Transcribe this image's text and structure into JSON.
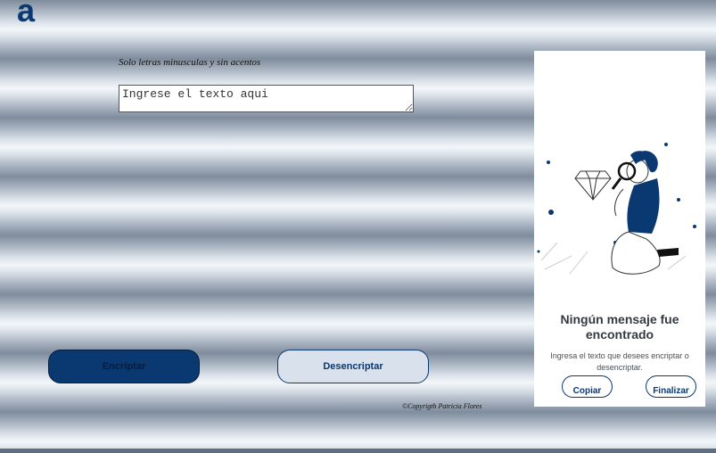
{
  "header": {
    "logo_text": "a"
  },
  "form": {
    "hint": "Solo letras minusculas y sin acentos",
    "input_placeholder": "Ingrese el texto aqui",
    "input_value": ""
  },
  "actions": {
    "encrypt_label": "Encriptar",
    "decrypt_label": "Desencriptar"
  },
  "footer": {
    "copyright": "©Copyrigth Patricia Flores"
  },
  "output_panel": {
    "title": "Ningún mensaje fue encontrado",
    "description": "Ingresa el texto que desees encriptar o desencriptar.",
    "copy_label": "Copiar",
    "finish_label": "Finalizar",
    "illustration_icon": "person-with-magnifier-and-diamond"
  },
  "colors": {
    "brand": "#0a3871",
    "button_secondary_bg": "#d8e1ec",
    "panel_bg": "#ffffff"
  }
}
